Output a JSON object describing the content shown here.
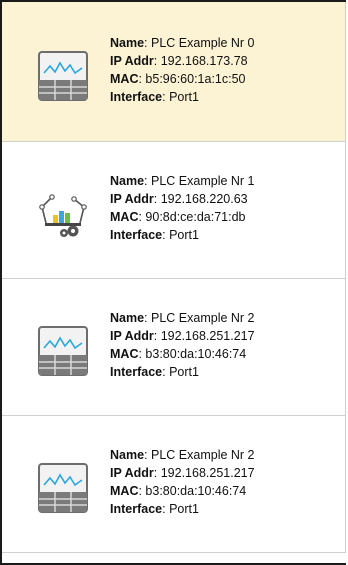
{
  "labels": {
    "name": "Name",
    "ip": "IP Addr",
    "mac": "MAC",
    "interface": "Interface"
  },
  "devices": [
    {
      "name": "PLC Example Nr 0",
      "ip": "192.168.173.78",
      "mac": "b5:96:60:1a:1c:50",
      "interface": "Port1",
      "icon": "plc-monitor-icon",
      "selected": true
    },
    {
      "name": "PLC Example Nr 1",
      "ip": "192.168.220.63",
      "mac": "90:8d:ce:da:71:db",
      "interface": "Port1",
      "icon": "robot-arm-gears-icon",
      "selected": false
    },
    {
      "name": "PLC Example Nr 2",
      "ip": "192.168.251.217",
      "mac": "b3:80:da:10:46:74",
      "interface": "Port1",
      "icon": "plc-monitor-icon",
      "selected": false
    },
    {
      "name": "PLC Example Nr 2",
      "ip": "192.168.251.217",
      "mac": "b3:80:da:10:46:74",
      "interface": "Port1",
      "icon": "plc-monitor-icon",
      "selected": false
    }
  ],
  "colors": {
    "selected_bg": "#fbf3d4",
    "accent_line": "#2aa7e0"
  }
}
